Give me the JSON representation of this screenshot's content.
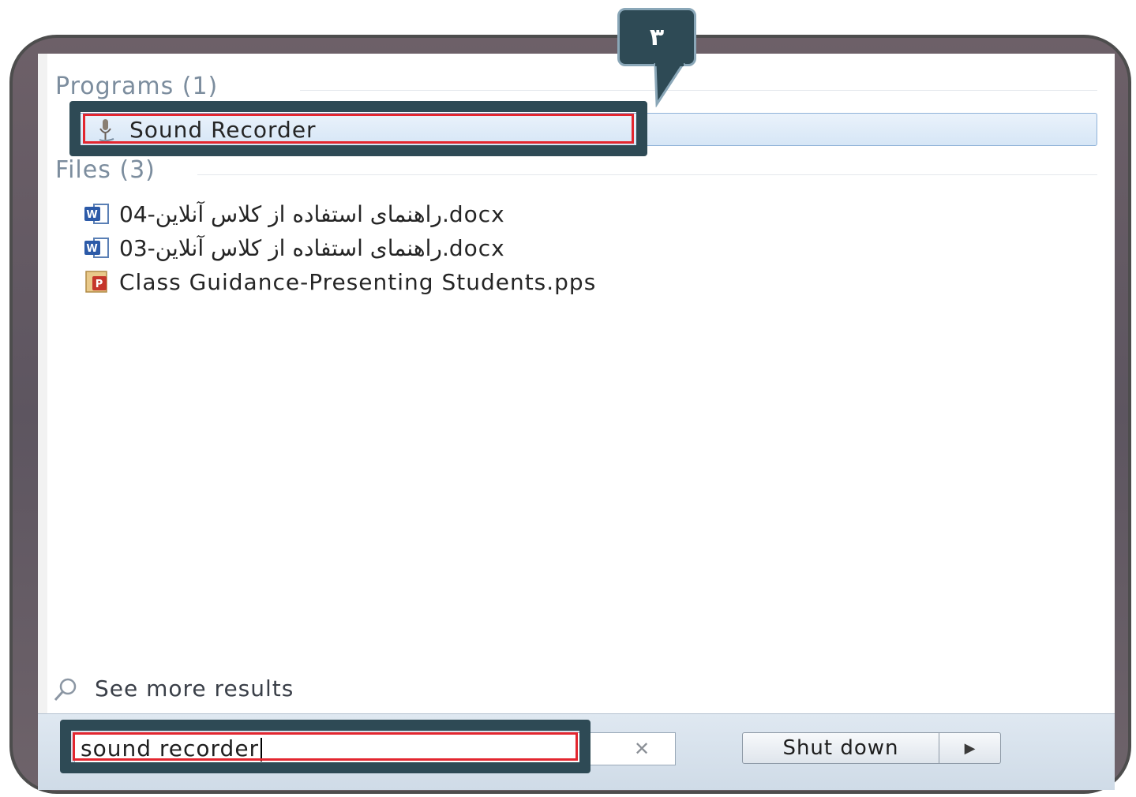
{
  "callout": {
    "step_number": "۳"
  },
  "programs": {
    "header": "Programs (1)",
    "items": [
      {
        "label": "Sound Recorder",
        "icon": "microphone-icon"
      }
    ]
  },
  "files": {
    "header": "Files (3)",
    "items": [
      {
        "label": "راهنمای استفاده از کلاس آنلاین-04.docx",
        "icon": "word-doc-icon"
      },
      {
        "label": "راهنمای استفاده از کلاس آنلاین-03.docx",
        "icon": "word-doc-icon"
      },
      {
        "label": "Class Guidance-Presenting Students.pps",
        "icon": "powerpoint-show-icon"
      }
    ]
  },
  "see_more": {
    "label": "See more results",
    "icon": "magnifier-icon"
  },
  "search": {
    "value": "sound recorder",
    "clear_icon": "clear-icon"
  },
  "shutdown": {
    "label": "Shut down",
    "arrow_icon": "right-triangle-icon"
  },
  "colors": {
    "callout": "#2e4a55",
    "callout_border": "#e3262f",
    "highlight": "#d6e6f6",
    "section_title": "#7c8d9e"
  }
}
